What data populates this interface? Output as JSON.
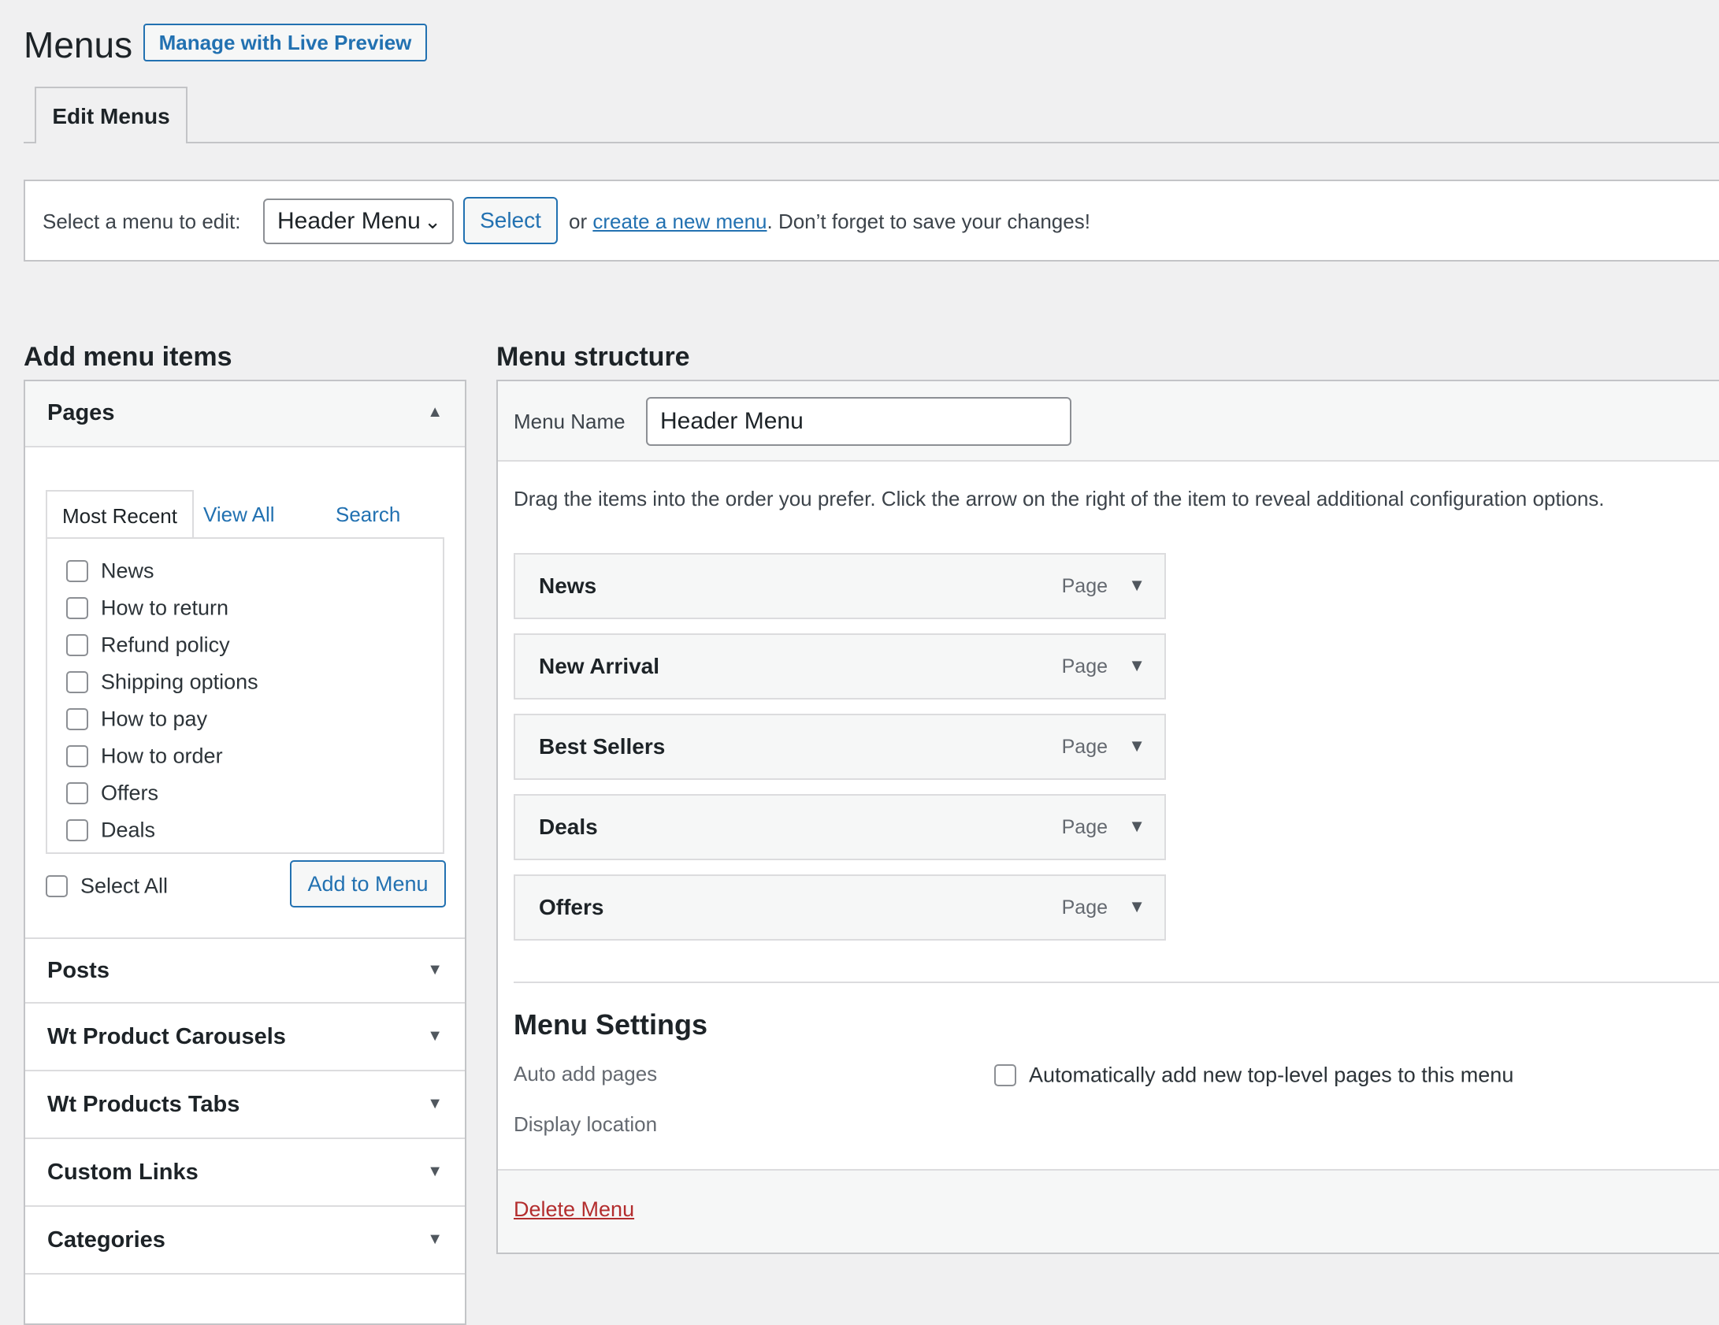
{
  "header": {
    "title": "Menus",
    "live_preview_button": "Manage with Live Preview",
    "tab_edit_menus": "Edit Menus"
  },
  "select_bar": {
    "label": "Select a menu to edit:",
    "selected_menu": "Header Menu",
    "select_button": "Select",
    "or_text": "or",
    "create_link": "create a new menu",
    "reminder": ". Don’t forget to save your changes!"
  },
  "add_items": {
    "heading": "Add menu items",
    "pages": {
      "title": "Pages",
      "tabs": [
        "Most Recent",
        "View All",
        "Search"
      ],
      "items": [
        "News",
        "How to return",
        "Refund policy",
        "Shipping options",
        "How to pay",
        "How to order",
        "Offers",
        "Deals"
      ],
      "select_all": "Select All",
      "add_button": "Add to Menu"
    },
    "sections": [
      "Posts",
      "Wt Product Carousels",
      "Wt Products Tabs",
      "Custom Links",
      "Categories"
    ]
  },
  "structure": {
    "heading": "Menu structure",
    "menu_name_label": "Menu Name",
    "menu_name_value": "Header Menu",
    "help_text": "Drag the items into the order you prefer. Click the arrow on the right of the item to reveal additional configuration options.",
    "items": [
      {
        "title": "News",
        "type": "Page"
      },
      {
        "title": "New Arrival",
        "type": "Page"
      },
      {
        "title": "Best Sellers",
        "type": "Page"
      },
      {
        "title": "Deals",
        "type": "Page"
      },
      {
        "title": "Offers",
        "type": "Page"
      }
    ],
    "settings": {
      "heading": "Menu Settings",
      "auto_add_label": "Auto add pages",
      "auto_add_option": "Automatically add new top-level pages to this menu",
      "display_location_label": "Display location"
    },
    "delete_link": "Delete Menu"
  },
  "colors": {
    "accent": "#2271b1",
    "danger": "#b32d2e",
    "background": "#f0f0f1"
  }
}
